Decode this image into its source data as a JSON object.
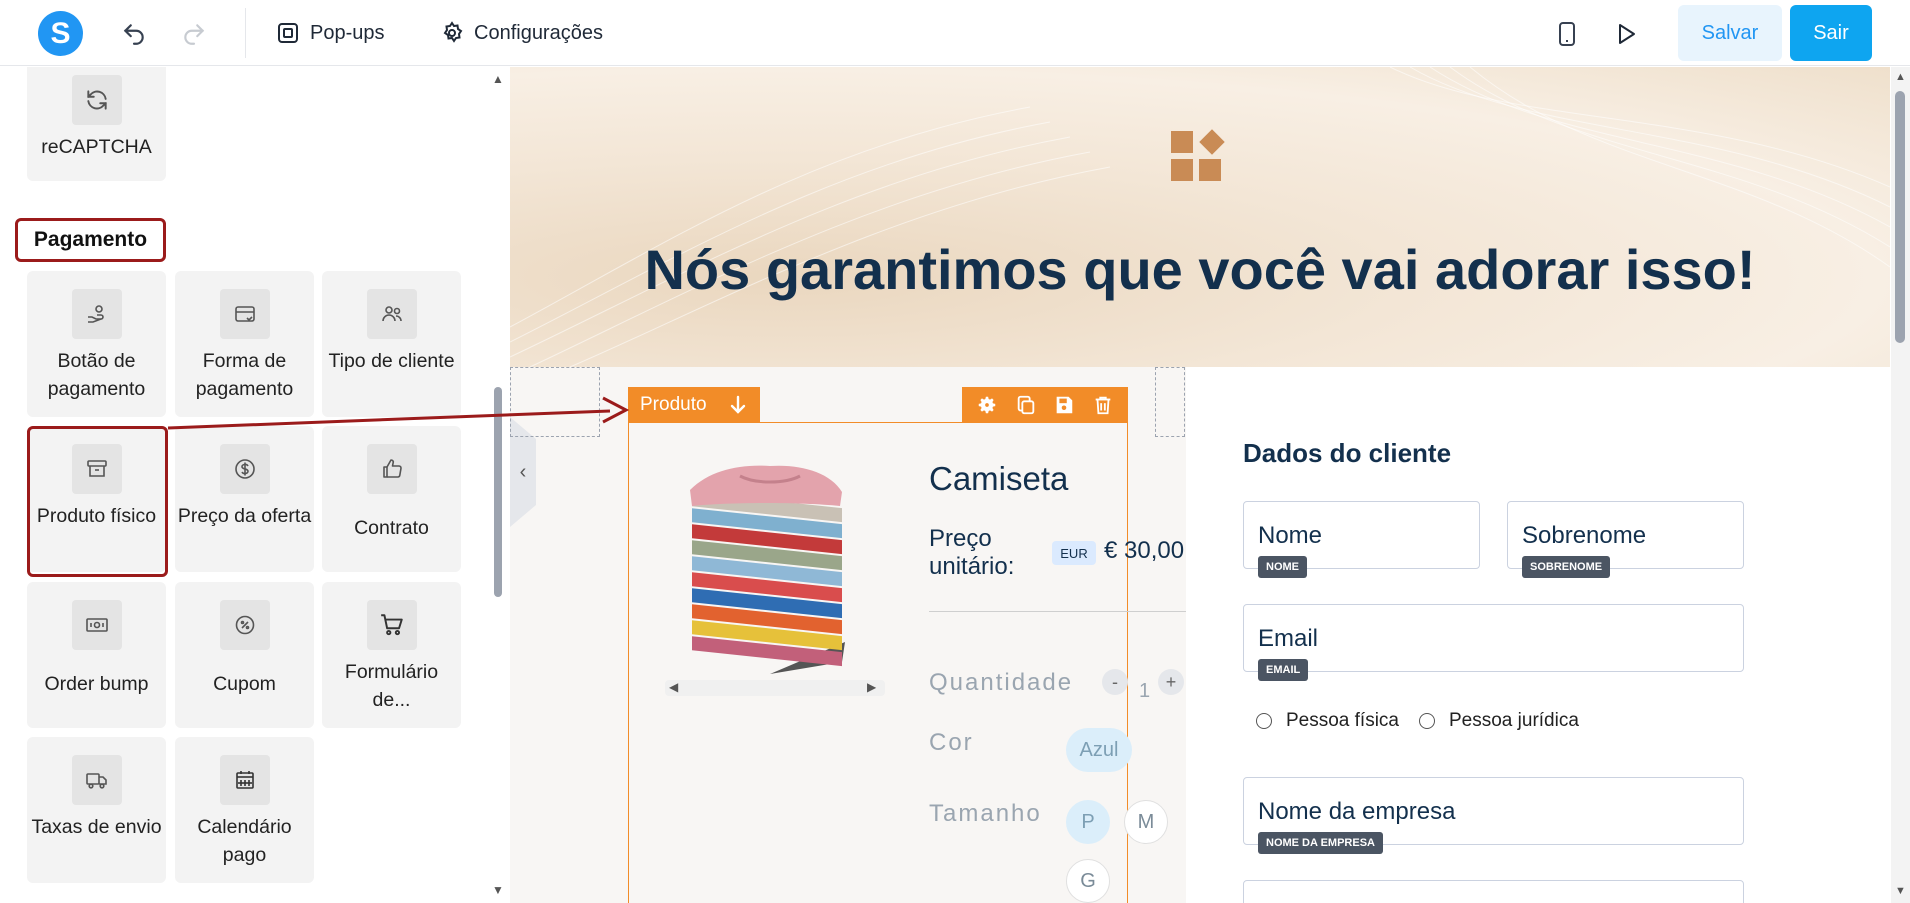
{
  "topbar": {
    "logo_letter": "S",
    "popups_label": "Pop-ups",
    "settings_label": "Configurações",
    "save_label": "Salvar",
    "exit_label": "Sair"
  },
  "sidebar": {
    "top_tile": {
      "label": "reCAPTCHA",
      "icon": "refresh-icon"
    },
    "section_title": "Pagamento",
    "tiles": [
      {
        "label": "Botão de pagamento",
        "icon": "hand-coin-icon"
      },
      {
        "label": "Forma de pagamento",
        "icon": "card-icon"
      },
      {
        "label": "Tipo de cliente",
        "icon": "users-icon"
      },
      {
        "label": "Produto físico",
        "icon": "archive-box-icon"
      },
      {
        "label": "Preço da oferta",
        "icon": "dollar-icon"
      },
      {
        "label": "Contrato",
        "icon": "thumbs-up-icon"
      },
      {
        "label": "Order bump",
        "icon": "banknote-icon"
      },
      {
        "label": "Cupom",
        "icon": "percent-badge-icon"
      },
      {
        "label": "Formulário de...",
        "icon": "cart-icon"
      },
      {
        "label": "Taxas de envio",
        "icon": "truck-icon"
      },
      {
        "label": "Calendário pago",
        "icon": "calendar-icon"
      }
    ]
  },
  "canvas": {
    "hero_title": "Nós garantimos que você vai adorar isso!",
    "product_block_label": "Produto",
    "product": {
      "title": "Camiseta",
      "price_label_1": "Preço",
      "price_label_2": "unitário:",
      "currency_badge": "EUR",
      "price": "€ 30,00",
      "quantity_label": "Quantidade",
      "quantity_minus": "-",
      "quantity_value": "1",
      "quantity_plus": "+",
      "color_label": "Cor",
      "color_value": "Azul",
      "size_label": "Tamanho",
      "sizes": [
        "P",
        "M",
        "G"
      ]
    },
    "form": {
      "title": "Dados do cliente",
      "first_name": {
        "placeholder": "Nome",
        "tag": "NOME"
      },
      "last_name": {
        "placeholder": "Sobrenome",
        "tag": "SOBRENOME"
      },
      "email": {
        "placeholder": "Email",
        "tag": "EMAIL"
      },
      "person_types": [
        "Pessoa física",
        "Pessoa jurídica"
      ],
      "company": {
        "placeholder": "Nome da empresa",
        "tag": "NOME DA EMPRESA"
      }
    }
  },
  "colors": {
    "accent": "#2196f3",
    "highlight_red": "#9b1b1b",
    "orange": "#f28c28",
    "navy": "#13304d"
  }
}
